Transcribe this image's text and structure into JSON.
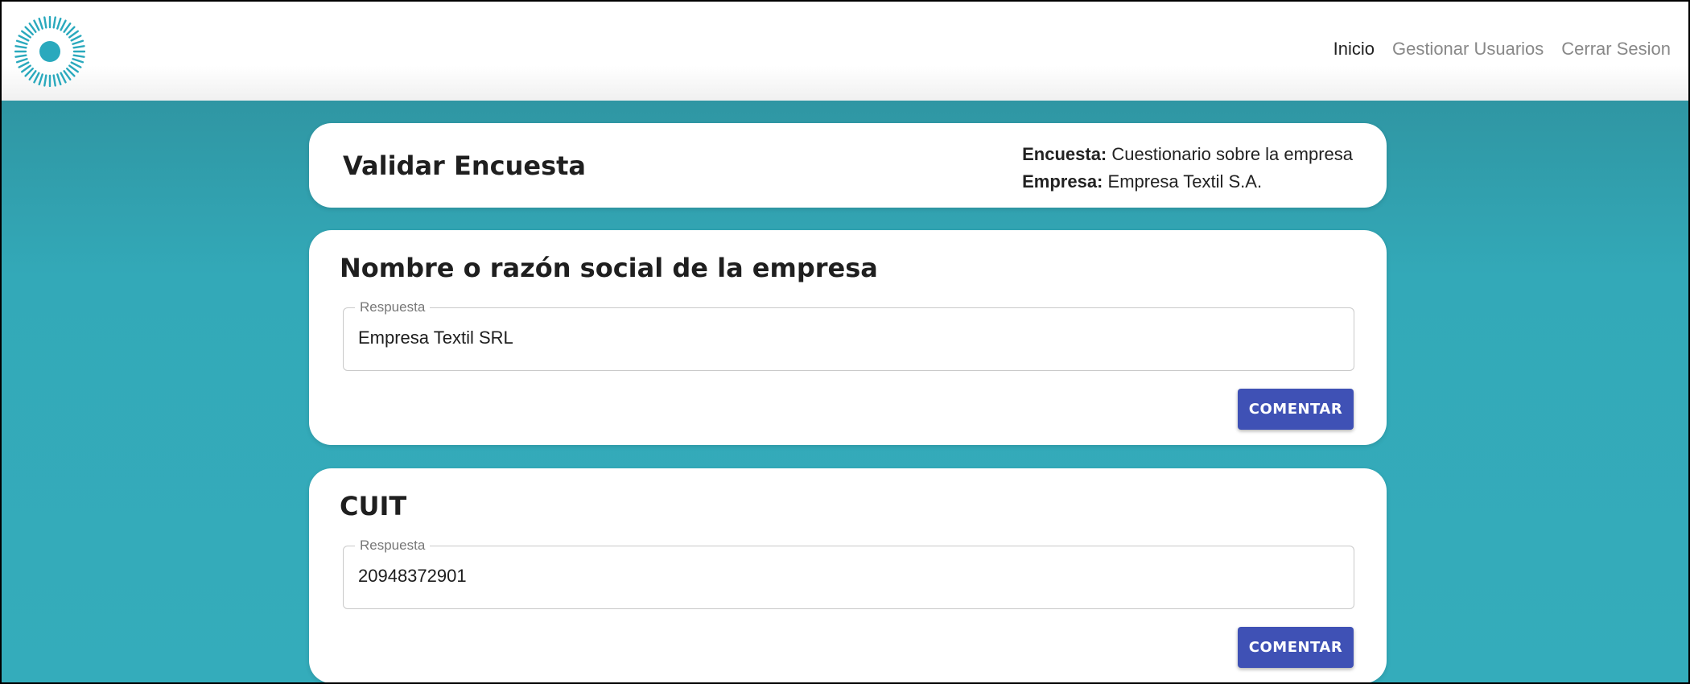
{
  "navbar": {
    "logo_icon": "sun-ring-logo",
    "links": [
      {
        "label": "Inicio",
        "active": true
      },
      {
        "label": "Gestionar Usuarios",
        "active": false
      },
      {
        "label": "Cerrar Sesion",
        "active": false
      }
    ]
  },
  "header": {
    "title": "Validar Encuesta",
    "survey_label": "Encuesta:",
    "survey_value": "Cuestionario sobre la empresa",
    "company_label": "Empresa:",
    "company_value": "Empresa Textil S.A."
  },
  "questions": [
    {
      "title": "Nombre o razón social de la empresa",
      "field_label": "Respuesta",
      "answer": "Empresa Textil SRL",
      "button_label": "COMENTAR"
    },
    {
      "title": "CUIT",
      "field_label": "Respuesta",
      "answer": "20948372901",
      "button_label": "COMENTAR"
    }
  ],
  "colors": {
    "accent": "#3f51b5",
    "background": "#32a9b9",
    "logo": "#2aa9bd"
  }
}
